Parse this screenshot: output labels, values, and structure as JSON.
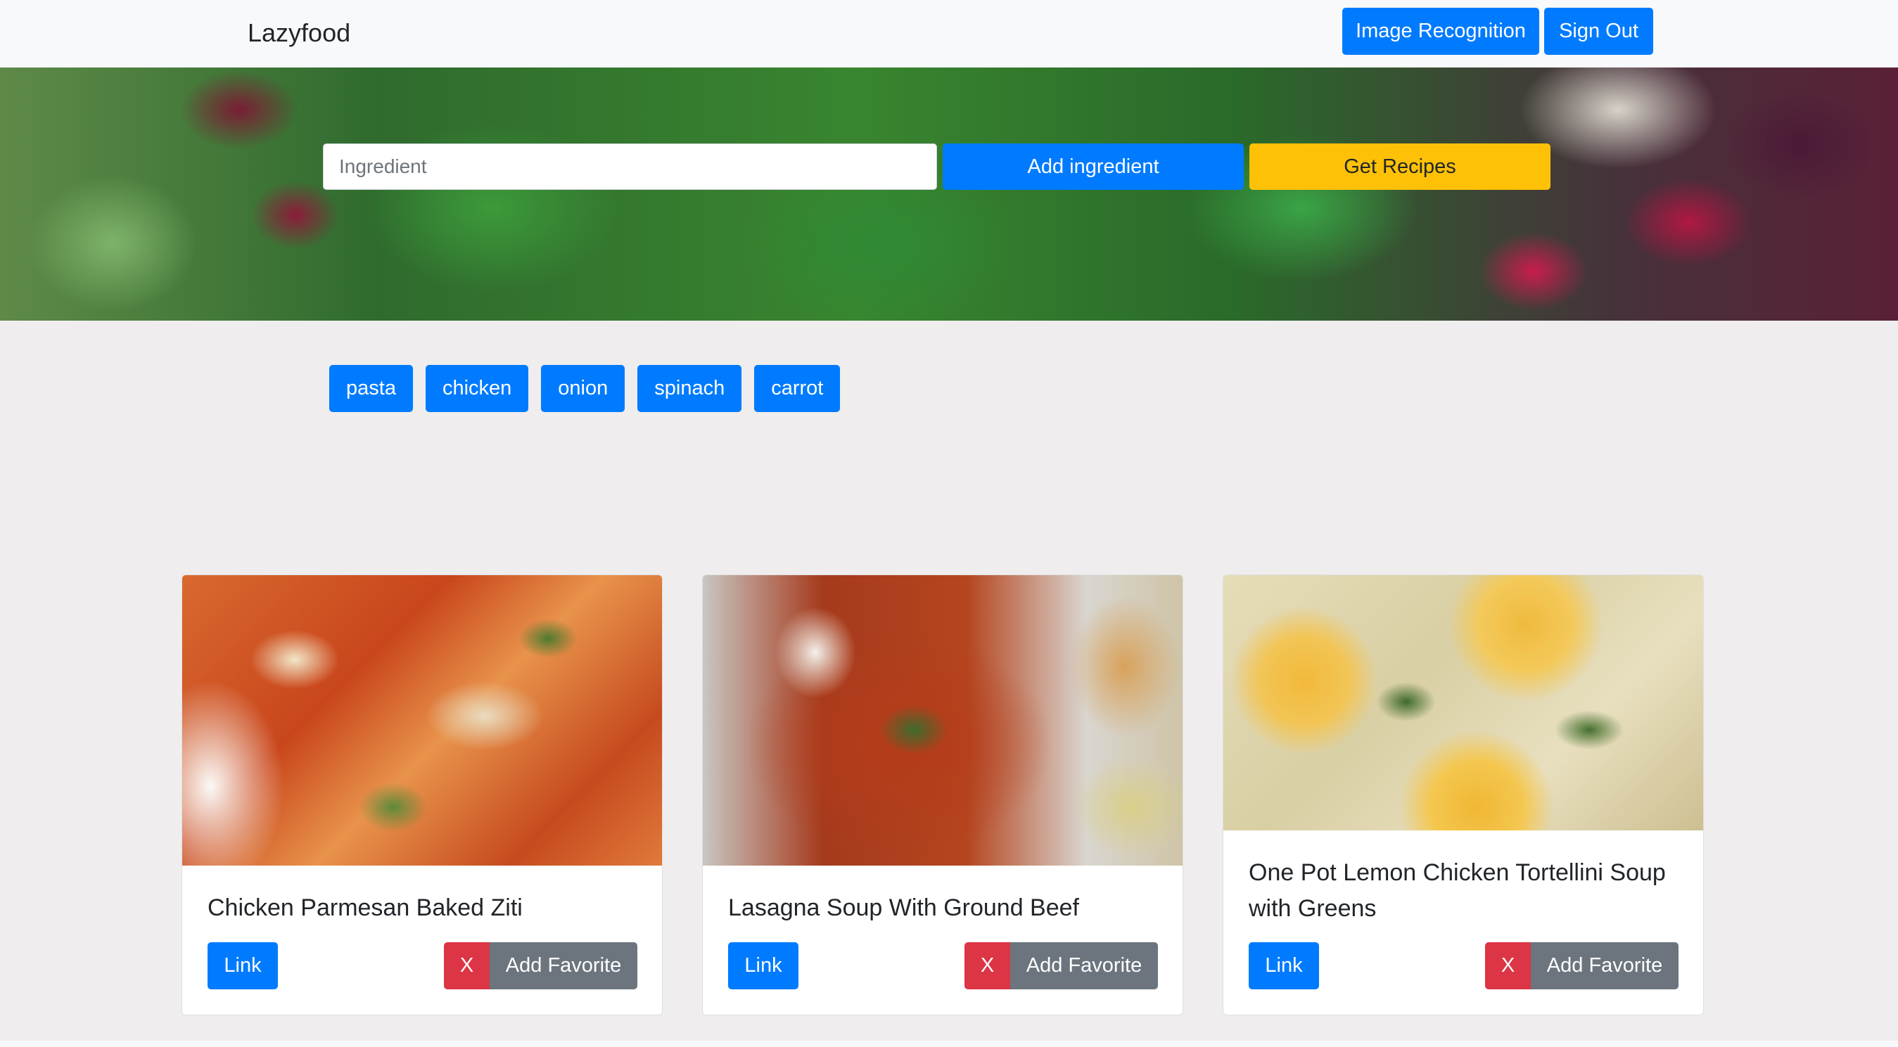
{
  "navbar": {
    "brand": "Lazyfood",
    "image_recognition_label": "Image Recognition",
    "sign_out_label": "Sign Out"
  },
  "search": {
    "placeholder": "Ingredient",
    "value": "",
    "add_label": "Add ingredient",
    "get_recipes_label": "Get Recipes"
  },
  "ingredients": [
    "pasta",
    "chicken",
    "onion",
    "spinach",
    "carrot"
  ],
  "recipes": [
    {
      "title": "Chicken Parmesan Baked Ziti",
      "link_label": "Link",
      "remove_label": "X",
      "favorite_label": "Add Favorite"
    },
    {
      "title": "Lasagna Soup With Ground Beef",
      "link_label": "Link",
      "remove_label": "X",
      "favorite_label": "Add Favorite"
    },
    {
      "title": "One Pot Lemon Chicken Tortellini Soup with Greens",
      "link_label": "Link",
      "remove_label": "X",
      "favorite_label": "Add Favorite"
    }
  ],
  "colors": {
    "primary": "#007bff",
    "warning": "#ffc107",
    "danger": "#dc3545",
    "secondary": "#6c757d",
    "background": "#efedee",
    "navbar": "#f8f9fa"
  }
}
